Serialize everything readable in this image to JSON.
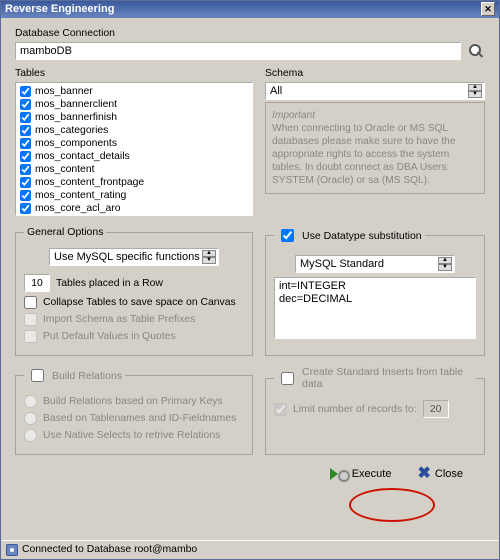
{
  "window": {
    "title": "Reverse Engineering"
  },
  "db": {
    "label": "Database Connection",
    "value": "mamboDB"
  },
  "tables": {
    "label": "Tables",
    "items": [
      {
        "name": "mos_banner",
        "checked": true
      },
      {
        "name": "mos_bannerclient",
        "checked": true
      },
      {
        "name": "mos_bannerfinish",
        "checked": true
      },
      {
        "name": "mos_categories",
        "checked": true
      },
      {
        "name": "mos_components",
        "checked": true
      },
      {
        "name": "mos_contact_details",
        "checked": true
      },
      {
        "name": "mos_content",
        "checked": true
      },
      {
        "name": "mos_content_frontpage",
        "checked": true
      },
      {
        "name": "mos_content_rating",
        "checked": true
      },
      {
        "name": "mos_core_acl_aro",
        "checked": true
      }
    ]
  },
  "schema": {
    "label": "Schema",
    "value": "All",
    "important_title": "Important",
    "important_text": "When connecting to Oracle or MS SQL databases please make sure to have the appropriate rights to access the system tables. In doubt connect as DBA Users: SYSTEM (Oracle) or sa (MS SQL)."
  },
  "general": {
    "title": "General Options",
    "func_combo": "Use MySQL specific functions",
    "row_count": "10",
    "row_label": "Tables placed in a Row",
    "collapse": "Collapse Tables to save space on Canvas",
    "import_prefix": "Import Schema as Table Prefixes",
    "quotes": "Put Default Values in Quotes"
  },
  "subst": {
    "title": "Use Datatype substitution",
    "checked": true,
    "combo": "MySQL Standard",
    "lines": [
      "int=INTEGER",
      "dec=DECIMAL"
    ]
  },
  "relations": {
    "title": "Build Relations",
    "checked": false,
    "pk": "Build Relations based on Primary Keys",
    "names": "Based on Tablenames and ID-Fieldnames",
    "native": "Use Native Selects to retrive Relations"
  },
  "inserts": {
    "title": "Create Standard Inserts from table data",
    "checked": false,
    "limit_label": "Limit number of records to:",
    "limit_value": "20"
  },
  "buttons": {
    "execute": "Execute",
    "close": "Close"
  },
  "status": {
    "text": "Connected to Database root@mambo"
  }
}
